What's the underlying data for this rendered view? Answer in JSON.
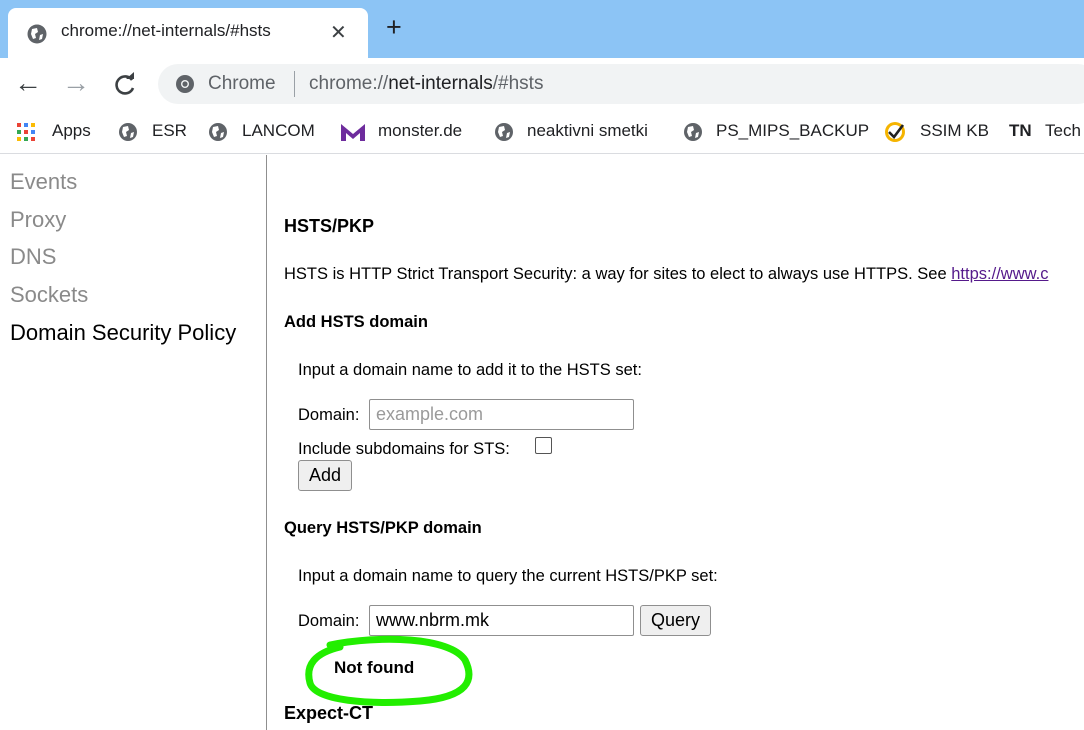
{
  "tab": {
    "title": "chrome://net-internals/#hsts",
    "close_icon": "close-icon",
    "new_tab_icon": "plus-icon"
  },
  "toolbar": {
    "back_icon": "arrow-left-icon",
    "forward_icon": "arrow-right-icon",
    "reload_icon": "reload-icon",
    "omnibox": {
      "site_label": "Chrome",
      "url_prefix": "chrome://",
      "url_host": "net-internals",
      "url_path": "/#hsts"
    }
  },
  "bookmarks": [
    {
      "label": "Apps",
      "icon": "apps-grid-icon"
    },
    {
      "label": "ESR",
      "icon": "globe-icon"
    },
    {
      "label": "LANCOM",
      "icon": "globe-icon"
    },
    {
      "label": "monster.de",
      "icon": "monster-logo-icon"
    },
    {
      "label": "neaktivni smetki",
      "icon": "globe-icon"
    },
    {
      "label": "PS_MIPS_BACKUP",
      "icon": "globe-icon"
    },
    {
      "label": "SSIM KB",
      "icon": "checkmark-badge-icon"
    },
    {
      "label": "Tech",
      "icon": "tn-logo-icon",
      "icon_text": "TN"
    }
  ],
  "sidebar": {
    "items": [
      {
        "label": "Events",
        "selected": false
      },
      {
        "label": "Proxy",
        "selected": false
      },
      {
        "label": "DNS",
        "selected": false
      },
      {
        "label": "Sockets",
        "selected": false
      },
      {
        "label": "Domain Security Policy",
        "selected": true
      }
    ]
  },
  "main": {
    "heading": "HSTS/PKP",
    "intro_text": "HSTS is HTTP Strict Transport Security: a way for sites to elect to always use HTTPS. See ",
    "intro_link": "https://www.c",
    "add_section": {
      "heading": "Add HSTS domain",
      "instructions": "Input a domain name to add it to the HSTS set:",
      "domain_label": "Domain:",
      "domain_placeholder": "example.com",
      "domain_value": "",
      "subdomains_label": "Include subdomains for STS:",
      "subdomains_checked": false,
      "add_button": "Add"
    },
    "query_section": {
      "heading": "Query HSTS/PKP domain",
      "instructions": "Input a domain name to query the current HSTS/PKP set:",
      "domain_label": "Domain:",
      "domain_value": "www.nbrm.mk",
      "query_button": "Query",
      "result": "Not found",
      "highlight_color": "#22ee00"
    },
    "expect_ct_heading": "Expect-CT"
  },
  "colors": {
    "tabstrip": "#8cc4f5",
    "omnibox": "#f1f3f4",
    "link": "#551a8b",
    "sidebar_muted": "#8a8a8a"
  }
}
